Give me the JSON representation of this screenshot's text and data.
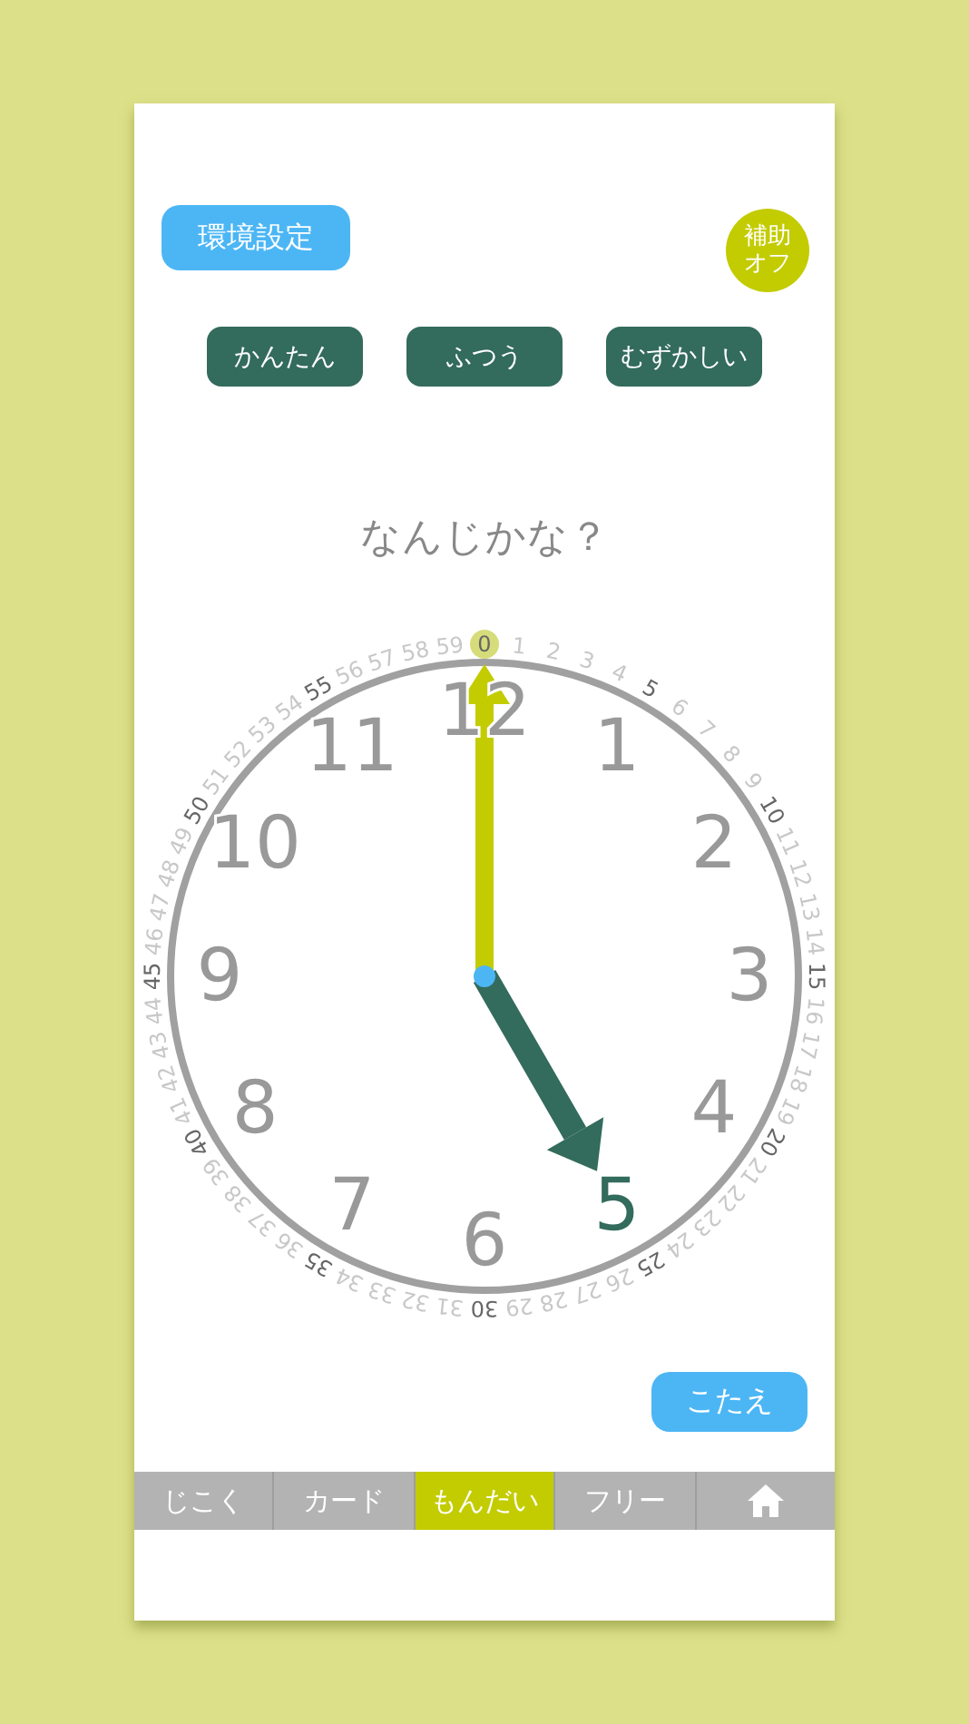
{
  "settings_button": "環境設定",
  "assist_toggle": {
    "lines": [
      "補助",
      "オフ"
    ]
  },
  "difficulty_buttons": [
    "かんたん",
    "ふつう",
    "むずかしい"
  ],
  "question": "なんじかな？",
  "clock": {
    "minute_labels": [
      {
        "label": "0",
        "major": true,
        "selected": true
      },
      {
        "label": "1",
        "major": false,
        "selected": false
      },
      {
        "label": "2",
        "major": false,
        "selected": false
      },
      {
        "label": "3",
        "major": false,
        "selected": false
      },
      {
        "label": "4",
        "major": false,
        "selected": false
      },
      {
        "label": "5",
        "major": true,
        "selected": false
      },
      {
        "label": "6",
        "major": false,
        "selected": false
      },
      {
        "label": "7",
        "major": false,
        "selected": false
      },
      {
        "label": "8",
        "major": false,
        "selected": false
      },
      {
        "label": "9",
        "major": false,
        "selected": false
      },
      {
        "label": "10",
        "major": true,
        "selected": false
      },
      {
        "label": "11",
        "major": false,
        "selected": false
      },
      {
        "label": "12",
        "major": false,
        "selected": false
      },
      {
        "label": "13",
        "major": false,
        "selected": false
      },
      {
        "label": "14",
        "major": false,
        "selected": false
      },
      {
        "label": "15",
        "major": true,
        "selected": false
      },
      {
        "label": "16",
        "major": false,
        "selected": false
      },
      {
        "label": "17",
        "major": false,
        "selected": false
      },
      {
        "label": "18",
        "major": false,
        "selected": false
      },
      {
        "label": "19",
        "major": false,
        "selected": false
      },
      {
        "label": "20",
        "major": true,
        "selected": false
      },
      {
        "label": "21",
        "major": false,
        "selected": false
      },
      {
        "label": "22",
        "major": false,
        "selected": false
      },
      {
        "label": "23",
        "major": false,
        "selected": false
      },
      {
        "label": "24",
        "major": false,
        "selected": false
      },
      {
        "label": "25",
        "major": true,
        "selected": false
      },
      {
        "label": "26",
        "major": false,
        "selected": false
      },
      {
        "label": "27",
        "major": false,
        "selected": false
      },
      {
        "label": "28",
        "major": false,
        "selected": false
      },
      {
        "label": "29",
        "major": false,
        "selected": false
      },
      {
        "label": "30",
        "major": true,
        "selected": false
      },
      {
        "label": "31",
        "major": false,
        "selected": false
      },
      {
        "label": "32",
        "major": false,
        "selected": false
      },
      {
        "label": "33",
        "major": false,
        "selected": false
      },
      {
        "label": "34",
        "major": false,
        "selected": false
      },
      {
        "label": "35",
        "major": true,
        "selected": false
      },
      {
        "label": "36",
        "major": false,
        "selected": false
      },
      {
        "label": "37",
        "major": false,
        "selected": false
      },
      {
        "label": "38",
        "major": false,
        "selected": false
      },
      {
        "label": "39",
        "major": false,
        "selected": false
      },
      {
        "label": "40",
        "major": true,
        "selected": false
      },
      {
        "label": "41",
        "major": false,
        "selected": false
      },
      {
        "label": "42",
        "major": false,
        "selected": false
      },
      {
        "label": "43",
        "major": false,
        "selected": false
      },
      {
        "label": "44",
        "major": false,
        "selected": false
      },
      {
        "label": "45",
        "major": true,
        "selected": false
      },
      {
        "label": "46",
        "major": false,
        "selected": false
      },
      {
        "label": "47",
        "major": false,
        "selected": false
      },
      {
        "label": "48",
        "major": false,
        "selected": false
      },
      {
        "label": "49",
        "major": false,
        "selected": false
      },
      {
        "label": "50",
        "major": true,
        "selected": false
      },
      {
        "label": "51",
        "major": false,
        "selected": false
      },
      {
        "label": "52",
        "major": false,
        "selected": false
      },
      {
        "label": "53",
        "major": false,
        "selected": false
      },
      {
        "label": "54",
        "major": false,
        "selected": false
      },
      {
        "label": "55",
        "major": true,
        "selected": false
      },
      {
        "label": "56",
        "major": false,
        "selected": false
      },
      {
        "label": "57",
        "major": false,
        "selected": false
      },
      {
        "label": "58",
        "major": false,
        "selected": false
      },
      {
        "label": "59",
        "major": false,
        "selected": false
      }
    ],
    "hour_labels": [
      {
        "label": "12",
        "selected": false
      },
      {
        "label": "1",
        "selected": false
      },
      {
        "label": "2",
        "selected": false
      },
      {
        "label": "3",
        "selected": false
      },
      {
        "label": "4",
        "selected": false
      },
      {
        "label": "5",
        "selected": true
      },
      {
        "label": "6",
        "selected": false
      },
      {
        "label": "7",
        "selected": false
      },
      {
        "label": "8",
        "selected": false
      },
      {
        "label": "9",
        "selected": false
      },
      {
        "label": "10",
        "selected": false
      },
      {
        "label": "11",
        "selected": false
      }
    ]
  },
  "answer_button": "こたえ",
  "tabs": [
    {
      "kind": "text",
      "label": "じこく",
      "selected": false
    },
    {
      "kind": "text",
      "label": "カード",
      "selected": false
    },
    {
      "kind": "text",
      "label": "もんだい",
      "selected": true
    },
    {
      "kind": "text",
      "label": "フリー",
      "selected": false
    },
    {
      "kind": "home",
      "selected": false
    }
  ]
}
